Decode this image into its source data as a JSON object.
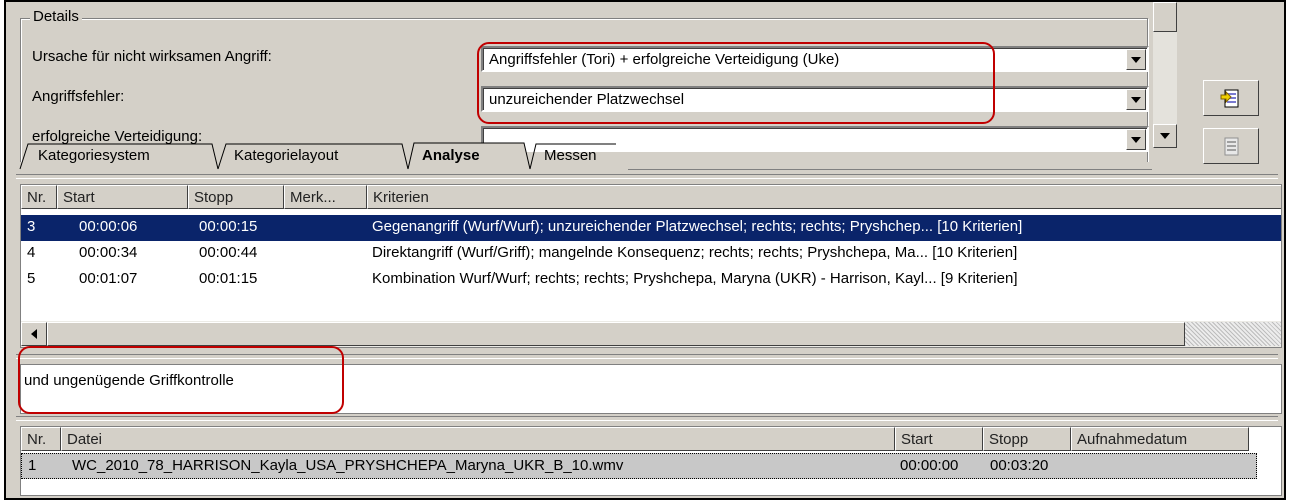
{
  "details": {
    "group_title": "Details",
    "fields": [
      {
        "label": "Ursache für nicht wirksamen Angriff:",
        "value": "Angriffsfehler (Tori) + erfolgreiche Verteidigung (Uke)"
      },
      {
        "label": "Angriffsfehler:",
        "value": "unzureichender Platzwechsel"
      },
      {
        "label": "erfolgreiche Verteidigung:",
        "value": ""
      }
    ]
  },
  "tabs": [
    {
      "label": "Kategoriesystem",
      "active": false
    },
    {
      "label": "Kategorielayout",
      "active": false
    },
    {
      "label": "Analyse",
      "active": true
    },
    {
      "label": "Messen",
      "active": false
    }
  ],
  "toolbar": {
    "import_icon": "import-document-icon",
    "export_icon": "export-document-icon"
  },
  "criteria_list": {
    "columns": [
      "Nr.",
      "Start",
      "Stopp",
      "Merk...",
      "Kriterien"
    ],
    "rows": [
      {
        "nr": "3",
        "start": "00:00:06",
        "stopp": "00:00:15",
        "merk": "",
        "kriterien": "Gegenangriff (Wurf/Wurf); unzureichender Platzwechsel; rechts; rechts; Pryshchep... [10 Kriterien]",
        "selected": true
      },
      {
        "nr": "4",
        "start": "00:00:34",
        "stopp": "00:00:44",
        "merk": "",
        "kriterien": "Direktangriff (Wurf/Griff); mangelnde Konsequenz; rechts; rechts; Pryshchepa, Ma... [10 Kriterien]",
        "selected": false
      },
      {
        "nr": "5",
        "start": "00:01:07",
        "stopp": "00:01:15",
        "merk": "",
        "kriterien": "Kombination Wurf/Wurf; rechts; rechts; Pryshchepa, Maryna (UKR) - Harrison, Kayl... [9 Kriterien]",
        "selected": false
      }
    ]
  },
  "note": {
    "text": "und ungenügende Griffkontrolle"
  },
  "files_list": {
    "columns": [
      "Nr.",
      "Datei",
      "Start",
      "Stopp",
      "Aufnahmedatum"
    ],
    "rows": [
      {
        "nr": "1",
        "datei": "WC_2010_78_HARRISON_Kayla_USA_PRYSHCHEPA_Maryna_UKR_B_10.wmv",
        "start": "00:00:00",
        "stopp": "00:03:20",
        "datum": ""
      }
    ]
  },
  "colors": {
    "selection": "#0a246a",
    "highlight_annotation": "#c00000",
    "window_face": "#d4d0c8"
  }
}
